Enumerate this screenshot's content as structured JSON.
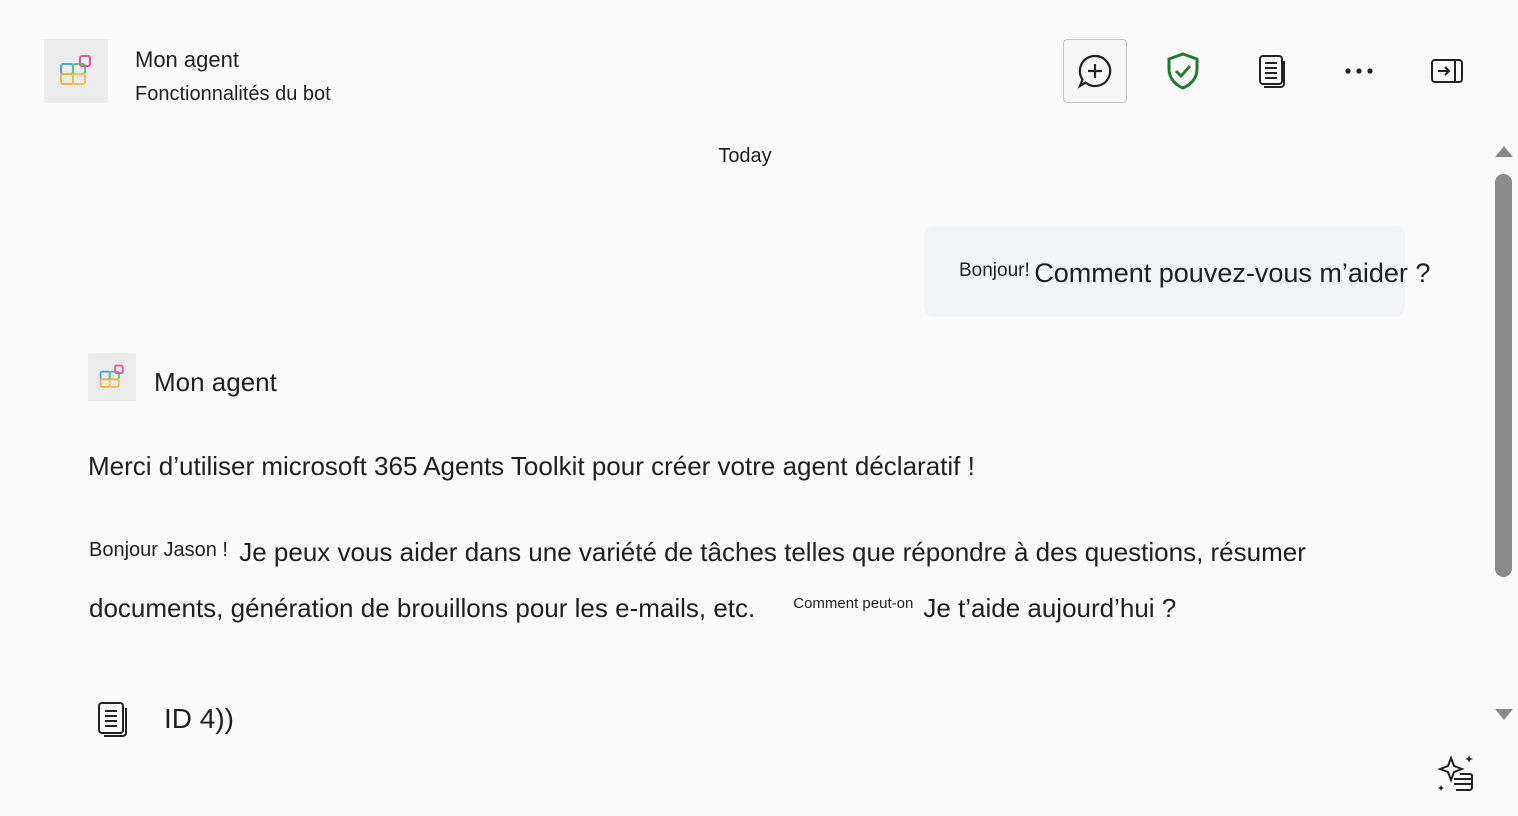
{
  "header": {
    "agent_name": "Mon agent",
    "agent_subtitle": "Fonctionnalités du bot",
    "buttons": {
      "new_chat": "new-chat-icon",
      "shield": "shield-check-icon",
      "document": "document-icon",
      "more": "more-horizontal-icon",
      "collapse": "panel-collapse-icon"
    }
  },
  "chat": {
    "date_separator": "Today",
    "user_message": {
      "prefix": "Bonjour!",
      "text": "Comment pouvez-vous m’aider ?"
    },
    "bot": {
      "name": "Mon agent",
      "line1": "Merci d’utiliser microsoft 365 Agents Toolkit pour créer votre agent déclaratif !",
      "line2_prefix": "Bonjour Jason !",
      "line2_text": "Je peux vous aider dans une variété de tâches telles que répondre à des questions, résumer",
      "line3_text": "documents, génération de brouillons pour les e-mails, etc.",
      "line3_tag": "Comment peut-on",
      "line3_end": "Je t’aide aujourd’hui ?",
      "reference_label": "ID 4))"
    }
  },
  "colors": {
    "background": "#fafafa",
    "shield_green": "#1e7b34",
    "scrollbar": "#8a8a8a",
    "bubble": "#f3f4f6"
  }
}
